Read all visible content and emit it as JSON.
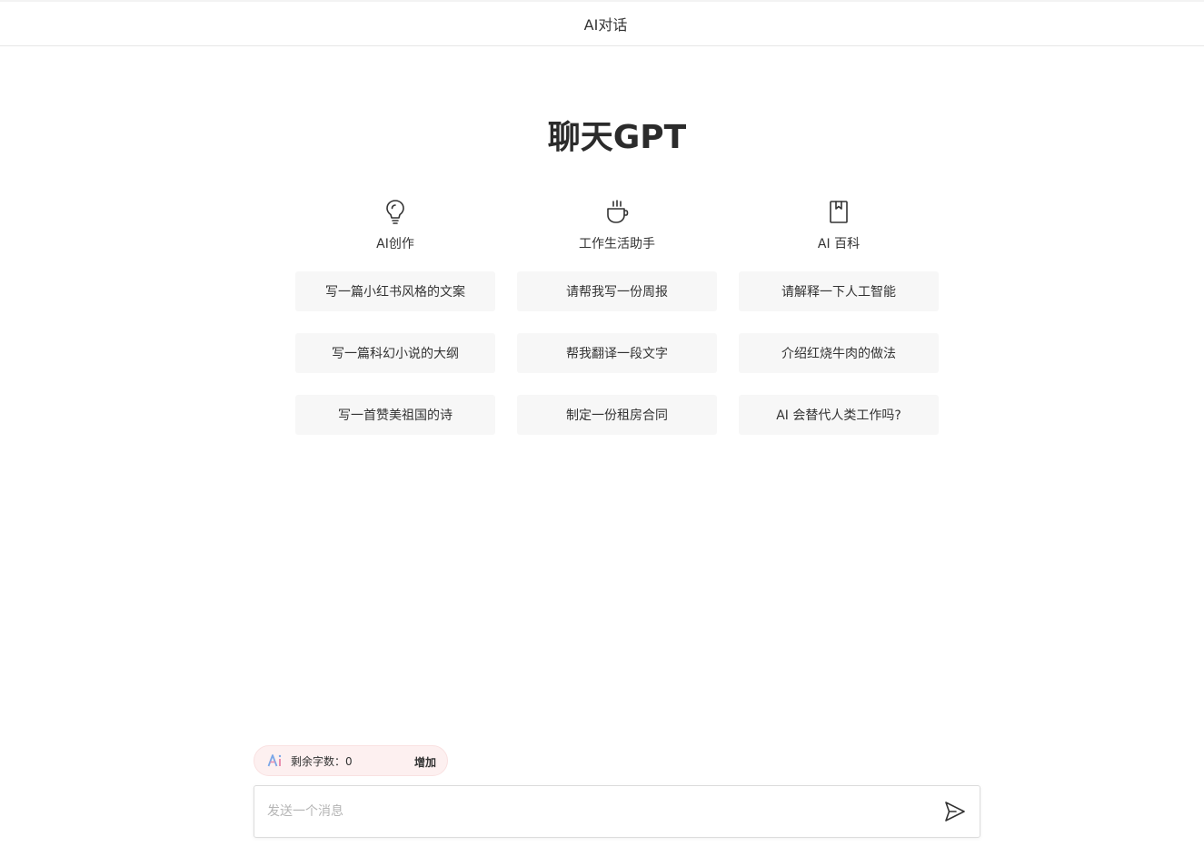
{
  "header": {
    "title": "AI对话"
  },
  "hero": {
    "title": "聊天GPT"
  },
  "columns": [
    {
      "icon": "lightbulb-icon",
      "label": "AI创作",
      "prompts": [
        "写一篇小红书风格的文案",
        "写一篇科幻小说的大纲",
        "写一首赞美祖国的诗"
      ]
    },
    {
      "icon": "coffee-cup-icon",
      "label": "工作生活助手",
      "prompts": [
        "请帮我写一份周报",
        "帮我翻译一段文字",
        "制定一份租房合同"
      ]
    },
    {
      "icon": "book-bookmark-icon",
      "label": "AI 百科",
      "prompts": [
        "请解释一下人工智能",
        "介绍红烧牛肉的做法",
        "AI 会替代人类工作吗?"
      ]
    }
  ],
  "quota": {
    "label": "剩余字数：0",
    "add_label": "增加",
    "icon": "ai-logo-icon"
  },
  "composer": {
    "placeholder": "发送一个消息",
    "value": "",
    "send_icon": "send-icon"
  },
  "colors": {
    "card_bg": "#f7f7f7",
    "quota_bg": "#fdf0f0",
    "text": "#333333"
  }
}
